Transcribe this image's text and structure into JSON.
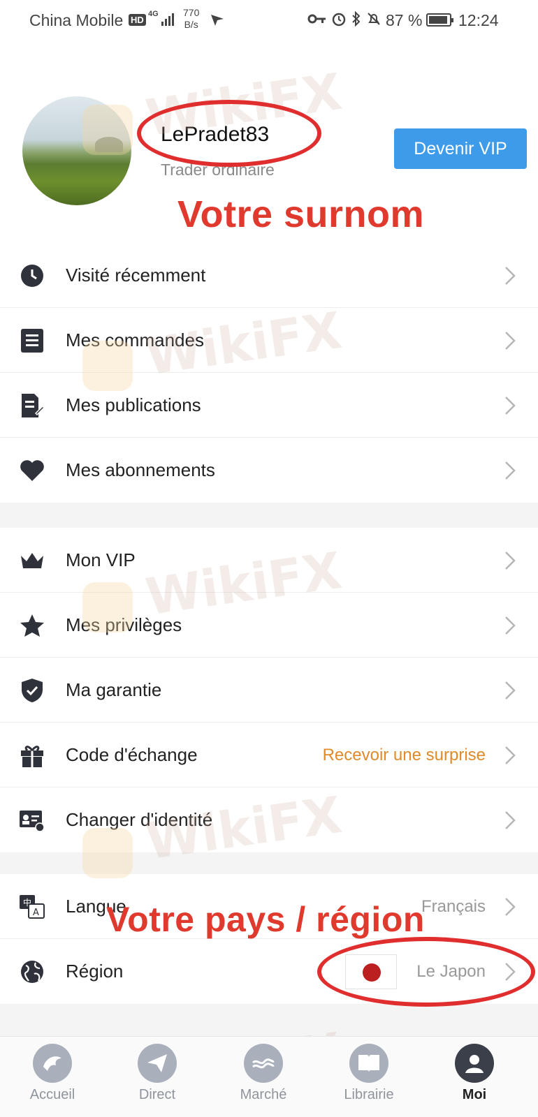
{
  "status_bar": {
    "carrier": "China Mobile",
    "hd": "HD",
    "network": "4G",
    "speed_value": "770",
    "speed_unit": "B/s",
    "battery": "87 %",
    "time": "12:24"
  },
  "profile": {
    "username": "LePradet83",
    "rank": "Trader ordinaire",
    "vip_button": "Devenir VIP"
  },
  "annotations": {
    "nickname": "Votre surnom",
    "country": "Votre pays / région"
  },
  "watermark": "WikiFX",
  "section1": [
    {
      "icon": "clock-icon",
      "label": "Visité récemment"
    },
    {
      "icon": "list-icon",
      "label": "Mes commandes"
    },
    {
      "icon": "edit-document-icon",
      "label": "Mes publications"
    },
    {
      "icon": "heart-icon",
      "label": "Mes abonnements"
    }
  ],
  "section2": [
    {
      "icon": "crown-icon",
      "label": "Mon VIP"
    },
    {
      "icon": "star-icon",
      "label": "Mes privilèges"
    },
    {
      "icon": "shield-check-icon",
      "label": "Ma garantie"
    },
    {
      "icon": "gift-icon",
      "label": "Code d'échange",
      "value": "Recevoir une surprise"
    },
    {
      "icon": "id-card-icon",
      "label": "Changer d'identité"
    }
  ],
  "section3": [
    {
      "icon": "translate-icon",
      "label": "Langue",
      "value": "Français"
    },
    {
      "icon": "globe-icon",
      "label": "Région",
      "value": "Le Japon"
    }
  ],
  "bottom_nav": [
    {
      "icon": "eagle-icon",
      "label": "Accueil",
      "active": false
    },
    {
      "icon": "paper-plane-icon",
      "label": "Direct",
      "active": false
    },
    {
      "icon": "market-icon",
      "label": "Marché",
      "active": false
    },
    {
      "icon": "book-icon",
      "label": "Librairie",
      "active": false
    },
    {
      "icon": "user-icon",
      "label": "Moi",
      "active": true
    }
  ],
  "colors": {
    "vip_button": "#3d9be9",
    "annotation": "#e03a2e",
    "accent_value": "#e08a2a",
    "flag_red": "#bc1f1f"
  }
}
